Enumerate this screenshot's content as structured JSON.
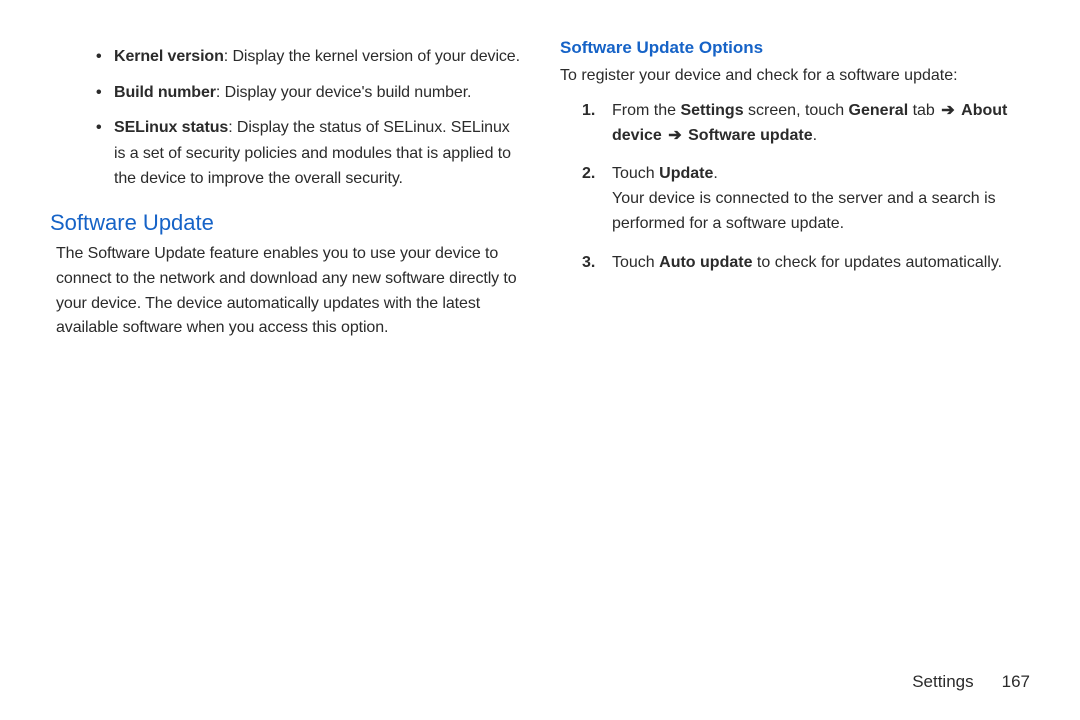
{
  "left": {
    "bullets": [
      {
        "bold": "Kernel version",
        "rest": ": Display the kernel version of your device."
      },
      {
        "bold": "Build number",
        "rest": ": Display your device's build number."
      },
      {
        "bold": "SELinux status",
        "rest": ": Display the status of SELinux. SELinux is a set of security policies and modules that is applied to the device to improve the overall security."
      }
    ],
    "heading": "Software Update",
    "paragraph": "The Software Update feature enables you to use your device to connect to the network and download any new software directly to your device. The device automatically updates with the latest available software when you access this option."
  },
  "right": {
    "heading": "Software Update Options",
    "intro": "To register your device and check for a software update:",
    "steps": {
      "s1": {
        "pre": "From the ",
        "settings": "Settings",
        "mid": " screen, touch ",
        "general": "General",
        "tab_word": " tab ",
        "arrow": "➔",
        "about": "About device",
        "arrow2": "➔",
        "sw": "Software update",
        "dot": "."
      },
      "s2": {
        "pre": "Touch ",
        "update": "Update",
        "dot": ".",
        "tail": "Your device is connected to the server and a search is performed for a software update."
      },
      "s3": {
        "pre": "Touch ",
        "auto": "Auto update",
        "tail": " to check for updates automatically."
      }
    }
  },
  "footer": {
    "section": "Settings",
    "page": "167"
  }
}
